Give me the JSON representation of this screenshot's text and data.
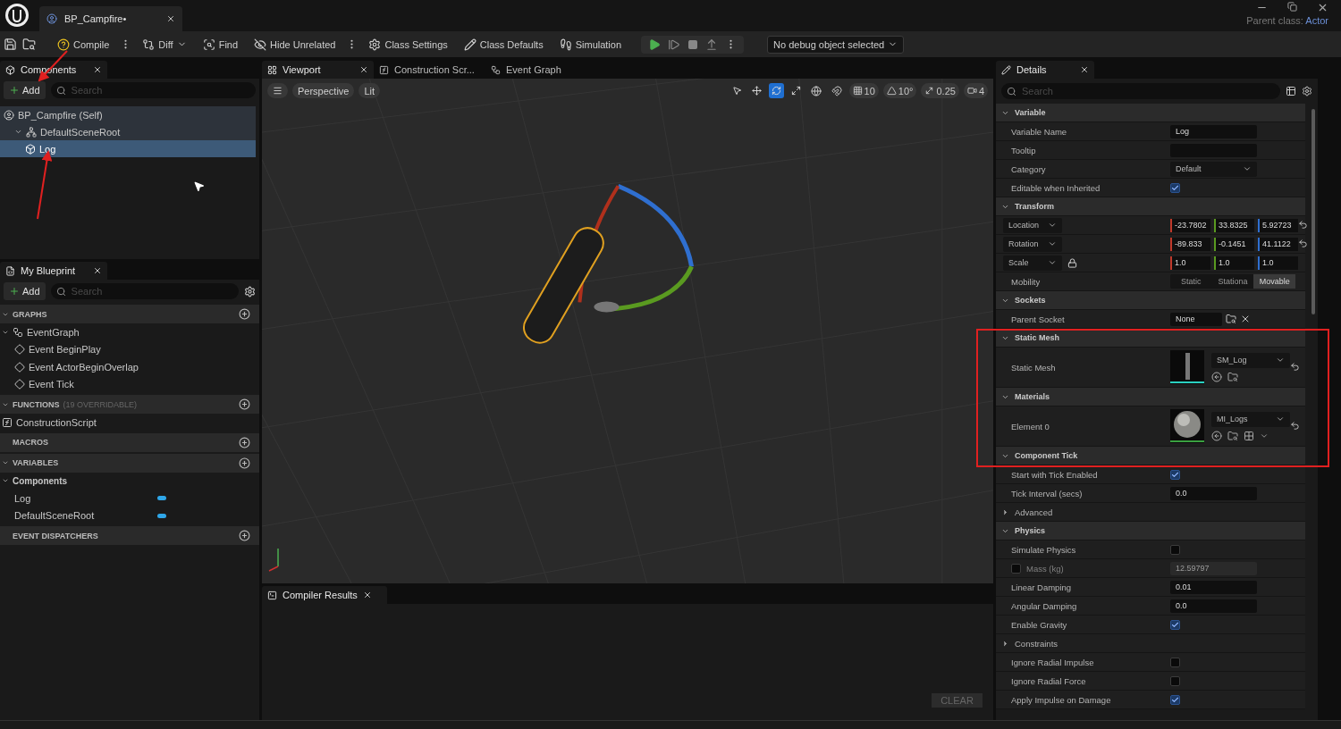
{
  "title_bar": {
    "document_tab": {
      "label": "BP_Campfire•",
      "selected": true
    },
    "parent_class_label": "Parent class:",
    "parent_class": "Actor"
  },
  "toolbar": {
    "buttons": [
      {
        "label": "Compile",
        "kind": "compile",
        "menu": true
      },
      {
        "label": "Diff",
        "kind": "diff",
        "dropdown": true
      },
      {
        "label": "Find",
        "kind": "find"
      },
      {
        "label": "Hide Unrelated",
        "kind": "hide",
        "menu": true
      },
      {
        "label": "Class Settings",
        "kind": "settings"
      },
      {
        "label": "Class Defaults",
        "kind": "defaults"
      },
      {
        "label": "Simulation",
        "kind": "simulation"
      }
    ],
    "debug_object": "No debug object selected"
  },
  "components": {
    "tab": "Components",
    "add": "Add",
    "search_placeholder": "Search",
    "tree": [
      {
        "label": "BP_Campfire (Self)",
        "kind": "self",
        "selected": false,
        "children": [
          {
            "label": "DefaultSceneRoot",
            "kind": "scene",
            "selected": false,
            "expanded": true,
            "children": [
              {
                "label": "Log",
                "kind": "mesh",
                "selected": true
              }
            ]
          }
        ]
      }
    ]
  },
  "my_blueprint": {
    "tab": "My Blueprint",
    "add": "Add",
    "search_placeholder": "Search",
    "sections": [
      {
        "title": "GRAPHS",
        "expanded": true,
        "items": [
          {
            "label": "EventGraph",
            "kind": "graph",
            "expanded": true,
            "children": [
              {
                "label": "Event BeginPlay",
                "kind": "event"
              },
              {
                "label": "Event ActorBeginOverlap",
                "kind": "event"
              },
              {
                "label": "Event Tick",
                "kind": "event"
              }
            ]
          }
        ]
      },
      {
        "title": "FUNCTIONS",
        "note": "(19 OVERRIDABLE)",
        "expanded": true,
        "items": [
          {
            "label": "ConstructionScript",
            "kind": "function"
          }
        ]
      },
      {
        "title": "MACROS"
      },
      {
        "title": "VARIABLES",
        "expanded": true,
        "items": [
          {
            "label": "Components",
            "kind": "category",
            "expanded": true,
            "children": [
              {
                "label": "Log",
                "kind": "variable"
              },
              {
                "label": "DefaultSceneRoot",
                "kind": "variable"
              }
            ]
          }
        ]
      },
      {
        "title": "EVENT DISPATCHERS"
      }
    ]
  },
  "viewport": {
    "tabs": [
      {
        "label": "Viewport",
        "kind": "viewport",
        "selected": true
      },
      {
        "label": "Construction Scr...",
        "kind": "function",
        "selected": false
      },
      {
        "label": "Event Graph",
        "kind": "graph",
        "selected": false
      }
    ],
    "view_mode": "Perspective",
    "lighting": "Lit",
    "tools": [
      {
        "kind": "select",
        "selected": false
      },
      {
        "kind": "move",
        "selected": false
      },
      {
        "kind": "rotate",
        "selected": true
      },
      {
        "kind": "scale",
        "selected": false
      }
    ],
    "snaps": [
      {
        "kind": "grid",
        "value": "10"
      },
      {
        "kind": "angle",
        "value": "10°"
      },
      {
        "kind": "scale",
        "value": "0.25"
      },
      {
        "kind": "camera",
        "value": "4"
      }
    ]
  },
  "compiler_results": {
    "tab": "Compiler Results",
    "clear": "CLEAR"
  },
  "details": {
    "tab": "Details",
    "search_placeholder": "Search",
    "rows": [
      {
        "kind": "section",
        "label": "Variable",
        "expanded": true
      },
      {
        "kind": "text",
        "label": "Variable Name",
        "value": "Log"
      },
      {
        "kind": "text",
        "label": "Tooltip"
      },
      {
        "kind": "dropdown",
        "label": "Category",
        "value": "Default"
      },
      {
        "kind": "checkbox",
        "label": "Editable when Inherited",
        "checked": true
      },
      {
        "kind": "section",
        "label": "Transform",
        "expanded": true
      },
      {
        "kind": "vector",
        "label": "Location",
        "values": [
          "-23.7802",
          "33.8325",
          "5.92723"
        ],
        "modified": true
      },
      {
        "kind": "vector",
        "label": "Rotation",
        "values": [
          "-89.833",
          "-0.1451",
          "41.1122"
        ],
        "modified": true
      },
      {
        "kind": "vector",
        "label": "Scale",
        "values": [
          "1.0",
          "1.0",
          "1.0"
        ],
        "locked": true
      },
      {
        "kind": "segmented",
        "label": "Mobility",
        "options": [
          {
            "label": "Static",
            "selected": false
          },
          {
            "label": "Stationa",
            "selected": false
          },
          {
            "label": "Movable",
            "selected": true
          }
        ]
      },
      {
        "kind": "section",
        "label": "Sockets",
        "expanded": true
      },
      {
        "kind": "socket",
        "label": "Parent Socket",
        "value": "None"
      },
      {
        "kind": "section",
        "label": "Static Mesh",
        "expanded": true
      },
      {
        "kind": "mesh_asset",
        "label": "Static Mesh",
        "value": "SM_Log",
        "modified": true
      },
      {
        "kind": "section",
        "label": "Materials",
        "expanded": true
      },
      {
        "kind": "material_asset",
        "label": "Element 0",
        "value": "MI_Logs",
        "modified": true
      },
      {
        "kind": "section",
        "label": "Component Tick",
        "expanded": true
      },
      {
        "kind": "checkbox",
        "label": "Start with Tick Enabled",
        "checked": true
      },
      {
        "kind": "text",
        "label": "Tick Interval (secs)",
        "value": "0.0"
      },
      {
        "kind": "group",
        "label": "Advanced",
        "expanded": false
      },
      {
        "kind": "section",
        "label": "Physics",
        "expanded": true
      },
      {
        "kind": "checkbox",
        "label": "Simulate Physics",
        "checked": false
      },
      {
        "kind": "mass",
        "label": "Mass (kg)",
        "checked": false,
        "value": "12.59797"
      },
      {
        "kind": "text",
        "label": "Linear Damping",
        "value": "0.01"
      },
      {
        "kind": "text",
        "label": "Angular Damping",
        "value": "0.0"
      },
      {
        "kind": "checkbox",
        "label": "Enable Gravity",
        "checked": true
      },
      {
        "kind": "group",
        "label": "Constraints",
        "expanded": false
      },
      {
        "kind": "checkbox",
        "label": "Ignore Radial Impulse",
        "checked": false
      },
      {
        "kind": "checkbox",
        "label": "Ignore Radial Force",
        "checked": false
      },
      {
        "kind": "checkbox",
        "label": "Apply Impulse on Damage",
        "checked": true
      }
    ]
  }
}
